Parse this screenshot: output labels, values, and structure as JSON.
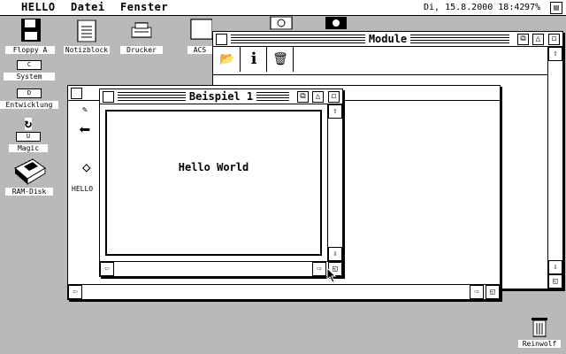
{
  "menubar": {
    "app_name": "HELLO",
    "menus": [
      "Datei",
      "Fenster"
    ],
    "clock": "Di, 15.8.2000 18:42",
    "memory": "97%"
  },
  "desktop": {
    "icons": [
      {
        "name": "floppy-icon",
        "label": "Floppy A"
      },
      {
        "name": "notepad-icon",
        "label": "Notizblock"
      },
      {
        "name": "printer-icon",
        "label": "Drucker"
      },
      {
        "name": "acs-icon",
        "label": "ACS"
      },
      {
        "name": "drive-c-icon",
        "drive": "C",
        "label": "System"
      },
      {
        "name": "drive-d-icon",
        "drive": "D",
        "label": "Entwicklung"
      },
      {
        "name": "drive-u-icon",
        "drive": "U",
        "label": "Magic"
      },
      {
        "name": "ramdisk-icon",
        "label": "RAM-Disk"
      },
      {
        "name": "trash-icon",
        "label": "Reinwolf"
      }
    ]
  },
  "windows": {
    "module": {
      "title": "Module"
    },
    "behind": {
      "item_label": "HELLO"
    },
    "beispiel": {
      "title": "Beispiel 1",
      "content": "Hello World"
    }
  }
}
